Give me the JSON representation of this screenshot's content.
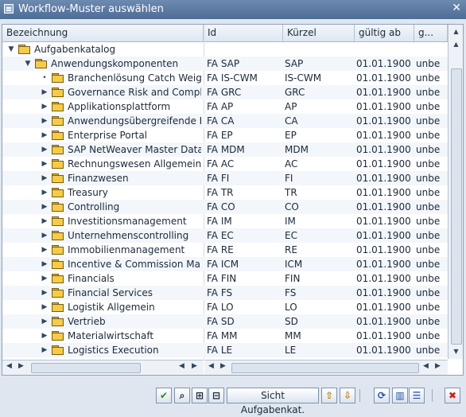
{
  "window": {
    "title": "Workflow-Muster auswählen",
    "close_glyph": "✕"
  },
  "columns": [
    "Bezeichnung",
    "Id",
    "Kürzel",
    "gültig ab",
    "g..."
  ],
  "tree": {
    "root": {
      "name": "Aufgabenkatalog"
    },
    "node": {
      "name": "Anwendungskomponenten",
      "id": "FA SAP",
      "kuerzel": "SAP",
      "gueltig_ab": "01.01.1900",
      "g": "unbe"
    },
    "items": [
      {
        "name": "Branchenlösung Catch Weight",
        "id": "FA IS-CWM",
        "kuerzel": "IS-CWM",
        "gueltig_ab": "01.01.1900",
        "g": "unbe"
      },
      {
        "name": "Governance Risk and Compliance",
        "id": "FA GRC",
        "kuerzel": "GRC",
        "gueltig_ab": "01.01.1900",
        "g": "unbe"
      },
      {
        "name": "Applikationsplattform",
        "id": "FA AP",
        "kuerzel": "AP",
        "gueltig_ab": "01.01.1900",
        "g": "unbe"
      },
      {
        "name": "Anwendungsübergreifende Ko",
        "id": "FA CA",
        "kuerzel": "CA",
        "gueltig_ab": "01.01.1900",
        "g": "unbe"
      },
      {
        "name": "Enterprise Portal",
        "id": "FA EP",
        "kuerzel": "EP",
        "gueltig_ab": "01.01.1900",
        "g": "unbe"
      },
      {
        "name": "SAP NetWeaver Master Data M",
        "id": "FA MDM",
        "kuerzel": "MDM",
        "gueltig_ab": "01.01.1900",
        "g": "unbe"
      },
      {
        "name": "Rechnungswesen Allgemein",
        "id": "FA AC",
        "kuerzel": "AC",
        "gueltig_ab": "01.01.1900",
        "g": "unbe"
      },
      {
        "name": "Finanzwesen",
        "id": "FA FI",
        "kuerzel": "FI",
        "gueltig_ab": "01.01.1900",
        "g": "unbe"
      },
      {
        "name": "Treasury",
        "id": "FA TR",
        "kuerzel": "TR",
        "gueltig_ab": "01.01.1900",
        "g": "unbe"
      },
      {
        "name": "Controlling",
        "id": "FA CO",
        "kuerzel": "CO",
        "gueltig_ab": "01.01.1900",
        "g": "unbe"
      },
      {
        "name": "Investitionsmanagement",
        "id": "FA IM",
        "kuerzel": "IM",
        "gueltig_ab": "01.01.1900",
        "g": "unbe"
      },
      {
        "name": "Unternehmenscontrolling",
        "id": "FA EC",
        "kuerzel": "EC",
        "gueltig_ab": "01.01.1900",
        "g": "unbe"
      },
      {
        "name": "Immobilienmanagement",
        "id": "FA RE",
        "kuerzel": "RE",
        "gueltig_ab": "01.01.1900",
        "g": "unbe"
      },
      {
        "name": "Incentive & Commission Manag",
        "id": "FA ICM",
        "kuerzel": "ICM",
        "gueltig_ab": "01.01.1900",
        "g": "unbe"
      },
      {
        "name": "Financials",
        "id": "FA FIN",
        "kuerzel": "FIN",
        "gueltig_ab": "01.01.1900",
        "g": "unbe"
      },
      {
        "name": "Financial Services",
        "id": "FA FS",
        "kuerzel": "FS",
        "gueltig_ab": "01.01.1900",
        "g": "unbe"
      },
      {
        "name": "Logistik Allgemein",
        "id": "FA LO",
        "kuerzel": "LO",
        "gueltig_ab": "01.01.1900",
        "g": "unbe"
      },
      {
        "name": "Vertrieb",
        "id": "FA SD",
        "kuerzel": "SD",
        "gueltig_ab": "01.01.1900",
        "g": "unbe"
      },
      {
        "name": "Materialwirtschaft",
        "id": "FA MM",
        "kuerzel": "MM",
        "gueltig_ab": "01.01.1900",
        "g": "unbe"
      },
      {
        "name": "Logistics Execution",
        "id": "FA LE",
        "kuerzel": "LE",
        "gueltig_ab": "01.01.1900",
        "g": "unbe"
      }
    ]
  },
  "toolbar": {
    "sicht_label": "Sicht Aufgabenkat.",
    "buttons": [
      {
        "name": "confirm-button",
        "icon": "check-icon",
        "glyph": "✔",
        "color": "#2e8b1e"
      },
      {
        "name": "find-button",
        "icon": "binoculars-icon",
        "glyph": "⌕",
        "color": "#1b2a3a"
      },
      {
        "name": "expand-button",
        "icon": "expand-icon",
        "glyph": "⊞",
        "color": "#1b2a3a"
      },
      {
        "name": "collapse-button",
        "icon": "collapse-icon",
        "glyph": "⊟",
        "color": "#1b2a3a"
      },
      {
        "name": "up-button",
        "icon": "folder-up-icon",
        "glyph": "⇧",
        "color": "#b08010"
      },
      {
        "name": "down-button",
        "icon": "folder-down-icon",
        "glyph": "⇩",
        "color": "#b08010"
      },
      {
        "name": "refresh-button",
        "icon": "refresh-icon",
        "glyph": "⟳",
        "color": "#1e4fa8"
      },
      {
        "name": "layout-button",
        "icon": "columns-icon",
        "glyph": "▥",
        "color": "#1e4fa8"
      },
      {
        "name": "list-button",
        "icon": "list-icon",
        "glyph": "☰",
        "color": "#1e4fa8"
      },
      {
        "name": "cancel-button",
        "icon": "cancel-icon",
        "glyph": "✖",
        "color": "#c81e1e"
      }
    ]
  }
}
